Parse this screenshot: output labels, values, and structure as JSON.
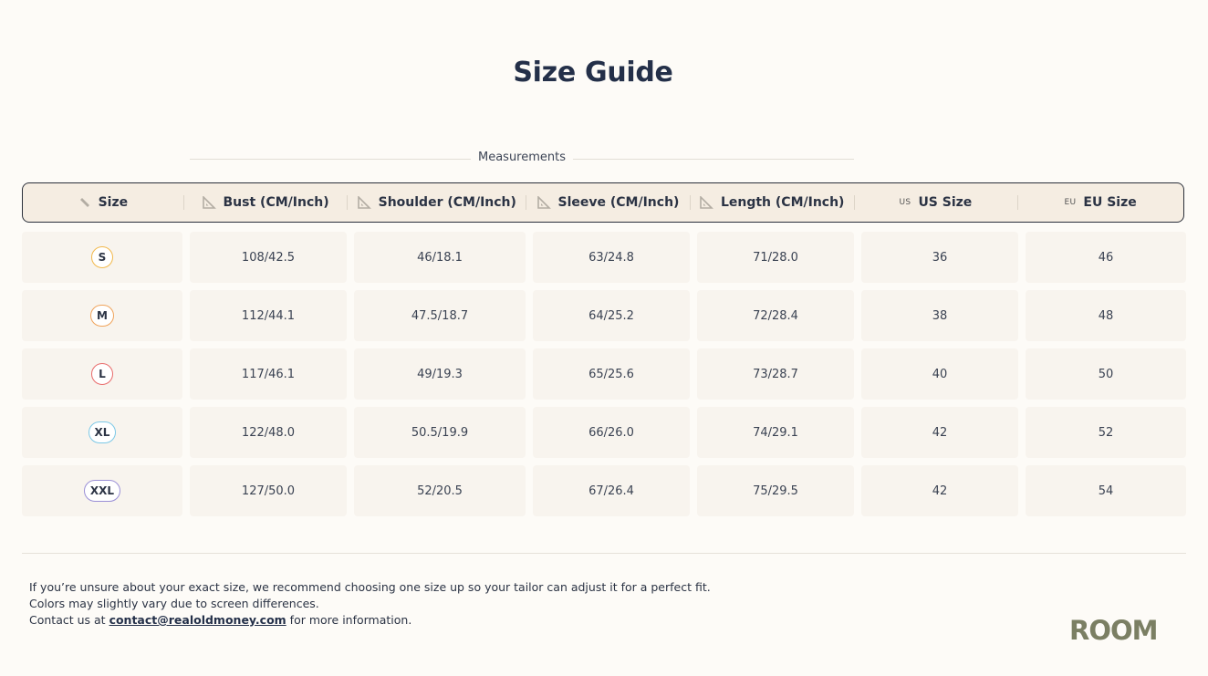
{
  "page": {
    "title": "Size Guide"
  },
  "measurements_label": "Measurements",
  "headers": {
    "size": "Size",
    "bust": "Bust (CM/Inch)",
    "shoulder": "Shoulder (CM/Inch)",
    "sleeve": "Sleeve (CM/Inch)",
    "length": "Length (CM/Inch)",
    "us_tag": "US",
    "us": "US Size",
    "eu_tag": "EU",
    "eu": "EU Size"
  },
  "header_icons": {
    "size": "ruler-icon",
    "bust": "set-square-icon",
    "shoulder": "set-square-icon",
    "sleeve": "set-square-icon",
    "length": "set-square-icon"
  },
  "rows": [
    {
      "size": "S",
      "badge_color": "#f2b84b",
      "bust": "108/42.5",
      "shoulder": "46/18.1",
      "sleeve": "63/24.8",
      "length": "71/28.0",
      "us": "36",
      "eu": "46"
    },
    {
      "size": "M",
      "badge_color": "#f0a35a",
      "bust": "112/44.1",
      "shoulder": "47.5/18.7",
      "sleeve": "64/25.2",
      "length": "72/28.4",
      "us": "38",
      "eu": "48"
    },
    {
      "size": "L",
      "badge_color": "#e86a6a",
      "bust": "117/46.1",
      "shoulder": "49/19.3",
      "sleeve": "65/25.6",
      "length": "73/28.7",
      "us": "40",
      "eu": "50"
    },
    {
      "size": "XL",
      "badge_color": "#7cc8e6",
      "bust": "122/48.0",
      "shoulder": "50.5/19.9",
      "sleeve": "66/26.0",
      "length": "74/29.1",
      "us": "42",
      "eu": "52"
    },
    {
      "size": "XXL",
      "badge_color": "#9a8fd6",
      "bust": "127/50.0",
      "shoulder": "52/20.5",
      "sleeve": "67/26.4",
      "length": "75/29.5",
      "us": "42",
      "eu": "54"
    }
  ],
  "footer": {
    "line1": "If you’re unsure about your exact size, we recommend choosing one size up so your tailor can adjust it for a perfect fit.",
    "line2": "Colors may slightly vary due to screen differences.",
    "line3_prefix": "Contact us at ",
    "email": "contact@realoldmoney.com",
    "line3_suffix": " for more information."
  },
  "brand": {
    "logo_text": "ROOM",
    "color": "#7b7f63"
  }
}
